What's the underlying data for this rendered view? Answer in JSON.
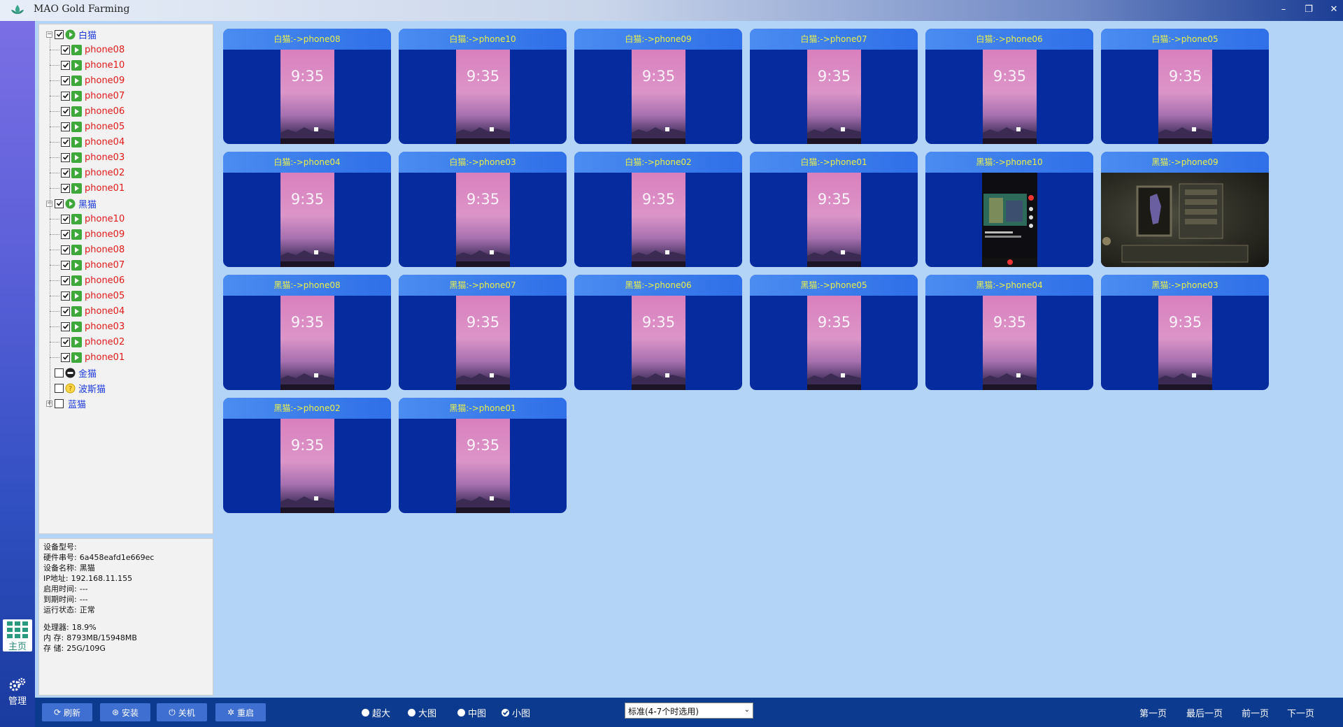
{
  "app": {
    "title": "MAO Gold Farming",
    "window_buttons": {
      "minimize": "–",
      "restore": "❐",
      "close": "✕"
    }
  },
  "nav": {
    "home_label": "主页",
    "manage_label": "管理"
  },
  "tree": {
    "groups": [
      {
        "name": "白猫",
        "expanded": true,
        "checked": true,
        "status": "play",
        "phones": [
          "phone08",
          "phone10",
          "phone09",
          "phone07",
          "phone06",
          "phone05",
          "phone04",
          "phone03",
          "phone02",
          "phone01"
        ]
      },
      {
        "name": "黑猫",
        "expanded": true,
        "checked": true,
        "status": "play",
        "phones": [
          "phone10",
          "phone09",
          "phone08",
          "phone07",
          "phone06",
          "phone05",
          "phone04",
          "phone03",
          "phone02",
          "phone01"
        ]
      },
      {
        "name": "金猫",
        "expanded": false,
        "checked": false,
        "status": "stop",
        "phones": []
      },
      {
        "name": "波斯猫",
        "expanded": false,
        "checked": false,
        "status": "warn",
        "phones": []
      },
      {
        "name": "蓝猫",
        "expanded": false,
        "checked": false,
        "status": "none",
        "collapsible": true,
        "phones": []
      }
    ]
  },
  "info": {
    "model_label": "设备型号:",
    "model_value": "",
    "serial_label": "硬件串号:",
    "serial_value": "6a458eafd1e669ec",
    "name_label": "设备名称:",
    "name_value": "黑猫",
    "ip_label": " IP地址:",
    "ip_value": "192.168.11.155",
    "start_label": "启用时间:",
    "start_value": "---",
    "expire_label": "到期时间:",
    "expire_value": "---",
    "state_label": "运行状态:",
    "state_value": "正常",
    "cpu_label": "处理器:",
    "cpu_value": "18.9%",
    "mem_label": "内 存:",
    "mem_value": "8793MB/15948MB",
    "disk_label": "存 储:",
    "disk_value": "25G/109G"
  },
  "devices": [
    {
      "title": "白猫:->phone08",
      "screen": "lock",
      "clock": "9:35"
    },
    {
      "title": "白猫:->phone10",
      "screen": "lock",
      "clock": "9:35"
    },
    {
      "title": "白猫:->phone09",
      "screen": "lock",
      "clock": "9:35"
    },
    {
      "title": "白猫:->phone07",
      "screen": "lock",
      "clock": "9:35"
    },
    {
      "title": "白猫:->phone06",
      "screen": "lock",
      "clock": "9:35"
    },
    {
      "title": "白猫:->phone05",
      "screen": "lock",
      "clock": "9:35"
    },
    {
      "title": "白猫:->phone04",
      "screen": "lock",
      "clock": "9:35"
    },
    {
      "title": "白猫:->phone03",
      "screen": "lock",
      "clock": "9:35"
    },
    {
      "title": "白猫:->phone02",
      "screen": "lock",
      "clock": "9:35"
    },
    {
      "title": "白猫:->phone01",
      "screen": "lock",
      "clock": "9:35"
    },
    {
      "title": "黑猫:->phone10",
      "screen": "tiktok",
      "clock": ""
    },
    {
      "title": "黑猫:->phone09",
      "screen": "game",
      "clock": ""
    },
    {
      "title": "黑猫:->phone08",
      "screen": "lock",
      "clock": "9:35"
    },
    {
      "title": "黑猫:->phone07",
      "screen": "lock",
      "clock": "9:35"
    },
    {
      "title": "黑猫:->phone06",
      "screen": "lock",
      "clock": "9:35"
    },
    {
      "title": "黑猫:->phone05",
      "screen": "lock",
      "clock": "9:35"
    },
    {
      "title": "黑猫:->phone04",
      "screen": "lock",
      "clock": "9:35"
    },
    {
      "title": "黑猫:->phone03",
      "screen": "lock",
      "clock": "9:35"
    },
    {
      "title": "黑猫:->phone02",
      "screen": "lock",
      "clock": "9:35"
    },
    {
      "title": "黑猫:->phone01",
      "screen": "lock",
      "clock": "9:35"
    }
  ],
  "toolbar": {
    "refresh": "刷新",
    "install": "安装",
    "shutdown": "关机",
    "reboot": "重启"
  },
  "view_sizes": {
    "options": [
      "超大",
      "大图",
      "中图",
      "小图"
    ],
    "selected": "小图"
  },
  "mode_select": {
    "value": "标准(4-7个时选用)"
  },
  "pager": {
    "first": "第一页",
    "last": "最后一页",
    "prev": "前一页",
    "next": "下一页"
  },
  "colors": {
    "accent": "#0b3a8e",
    "card_bg": "#062b9e",
    "card_title": "#e9f04a",
    "group_text": "#1e3cdc",
    "phone_text": "#e11919",
    "page_bg": "#b4d4f7"
  }
}
